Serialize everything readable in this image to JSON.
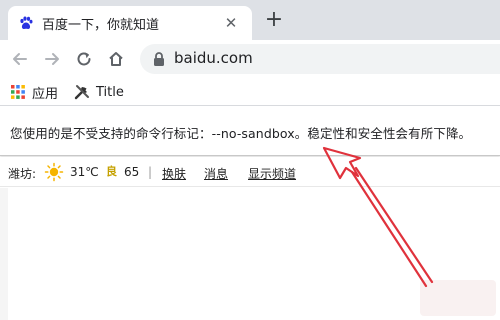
{
  "tab": {
    "title": "百度一下，你就知道",
    "close": "✕"
  },
  "new_tab": "+",
  "omnibox": {
    "url": "baidu.com"
  },
  "bookmarks": [
    {
      "label": "应用",
      "icon": "apps-grid-icon"
    },
    {
      "label": "Title",
      "icon": "tools-icon"
    }
  ],
  "infobar": {
    "message": "您使用的是不受支持的命令行标记：--no-sandbox。稳定性和安全性会有所下降。"
  },
  "baidu_bar": {
    "city": "潍坊:",
    "temperature": "31℃",
    "aqi_label": "良",
    "aqi_value": "65",
    "separator": "|",
    "skin": "换肤",
    "messages": "消息",
    "show_channel": "显示频道"
  },
  "colors": {
    "annotation_arrow": "#e0323c",
    "tab_strip": "#dee1e6"
  }
}
